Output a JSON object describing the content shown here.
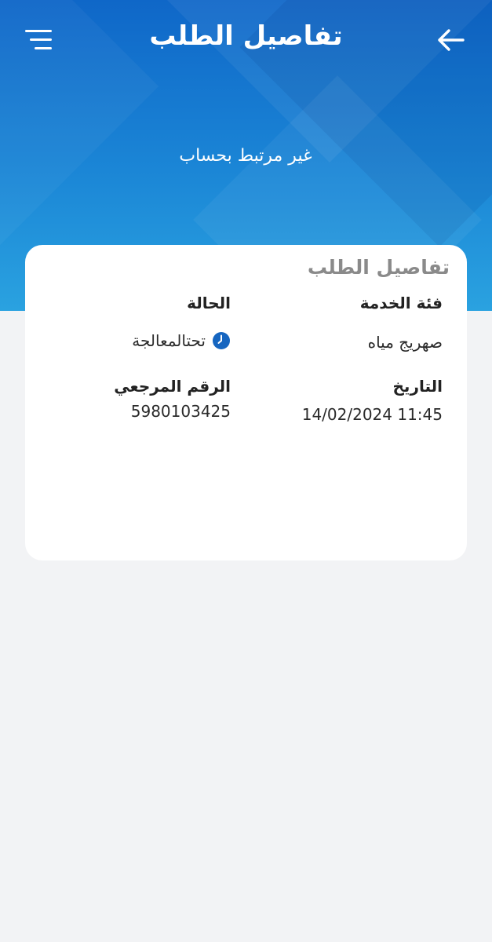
{
  "header": {
    "title": "تفاصيل الطلب",
    "menu_icon": "hamburger-menu-icon",
    "back_icon": "arrow-left-icon"
  },
  "hero": {
    "account_status": "غير مرتبط بحساب"
  },
  "card": {
    "title": "تفاصيل الطلب",
    "service_category_label": "فئة الخدمة",
    "service_category_value": "صهريج مياه",
    "status_label": "الحالة",
    "status_value": "تحتالمعالجة",
    "status_icon": "clock-icon",
    "date_label": "التاريخ",
    "date_value": "14/02/2024 11:45",
    "reference_label": "الرقم المرجعي",
    "reference_value": "5980103425"
  },
  "colors": {
    "header_blue_top": "#0f67c8",
    "header_blue_bottom": "#2aa2e0",
    "status_icon_blue": "#1565c0",
    "background": "#f2f3f5",
    "card": "#ffffff"
  }
}
